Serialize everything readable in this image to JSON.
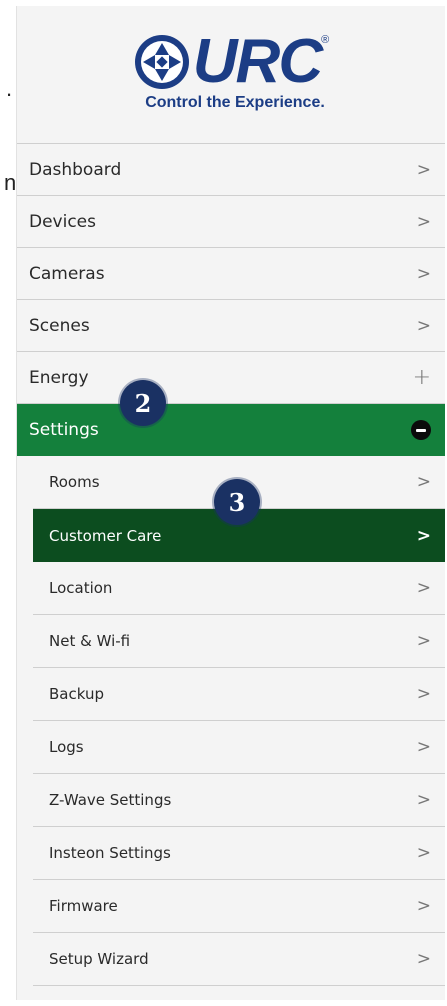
{
  "background_fragments": [
    ".",
    "n"
  ],
  "logo": {
    "wordmark": "URC",
    "registered": "®",
    "tagline": "Control the Experience.",
    "color": "#1c3d85"
  },
  "nav": [
    {
      "label": "Dashboard",
      "icon": "chevron-right-icon",
      "glyph": ">"
    },
    {
      "label": "Devices",
      "icon": "chevron-right-icon",
      "glyph": ">"
    },
    {
      "label": "Cameras",
      "icon": "chevron-right-icon",
      "glyph": ">"
    },
    {
      "label": "Scenes",
      "icon": "chevron-right-icon",
      "glyph": ">"
    },
    {
      "label": "Energy",
      "icon": "plus-icon",
      "glyph": "+"
    },
    {
      "label": "Settings",
      "icon": "minus-circle-icon",
      "active": true
    }
  ],
  "settings_sub": [
    {
      "label": "Rooms",
      "glyph": ">"
    },
    {
      "label": "Customer Care",
      "glyph": ">",
      "selected": true
    },
    {
      "label": "Location",
      "glyph": ">"
    },
    {
      "label": "Net & Wi-fi",
      "glyph": ">"
    },
    {
      "label": "Backup",
      "glyph": ">"
    },
    {
      "label": "Logs",
      "glyph": ">"
    },
    {
      "label": "Z-Wave Settings",
      "glyph": ">"
    },
    {
      "label": "Insteon Settings",
      "glyph": ">"
    },
    {
      "label": "Firmware",
      "glyph": ">"
    },
    {
      "label": "Setup Wizard",
      "glyph": ">"
    }
  ],
  "callouts": [
    "2",
    "3"
  ],
  "colors": {
    "active_green": "#14803c",
    "selected_dark_green": "#0c4d1f",
    "callout_navy": "#1a3163"
  }
}
